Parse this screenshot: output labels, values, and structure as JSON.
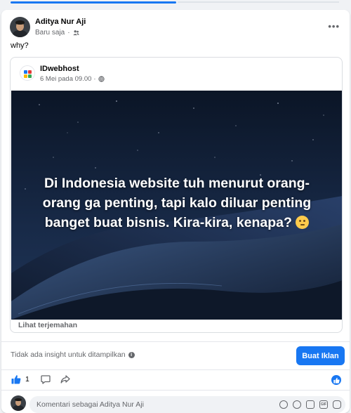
{
  "post": {
    "author": "Aditya Nur Aji",
    "time": "Baru saja",
    "audience_icon": "friends-icon",
    "more_label": "•••",
    "caption": "why?"
  },
  "shared_post": {
    "page_name": "IDwebhost",
    "time": "6 Mei pada 09.00",
    "audience_icon": "globe-icon",
    "image_text_lines": [
      "Di Indonesia website tuh menurut orang-",
      "orang ga penting, tapi kalo diluar penting",
      "banget buat bisnis. Kira-kira, kenapa?"
    ],
    "image_emoji": "thinking-face-emoji",
    "translate_label": "Lihat terjemahan",
    "logo_colors": [
      "#1877f2",
      "#e53935",
      "#fbbc05",
      "#34a853"
    ]
  },
  "insight": {
    "text": "Tidak ada insight untuk ditampilkan",
    "button_label": "Buat Iklan"
  },
  "actions": {
    "like_count": "1",
    "like_icon": "thumbs-up-icon",
    "comment_icon": "comment-icon",
    "share_icon": "share-icon",
    "reaction_icon": "like-reaction-icon"
  },
  "comment": {
    "placeholder": "Komentari sebagai Aditya Nur Aji",
    "icons": [
      "avatar-sticker-icon",
      "emoji-icon",
      "camera-icon",
      "gif-icon",
      "sticker-icon"
    ]
  },
  "colors": {
    "accent": "#1877f2",
    "background": "#f0f2f5",
    "secondary_text": "#65676b"
  }
}
